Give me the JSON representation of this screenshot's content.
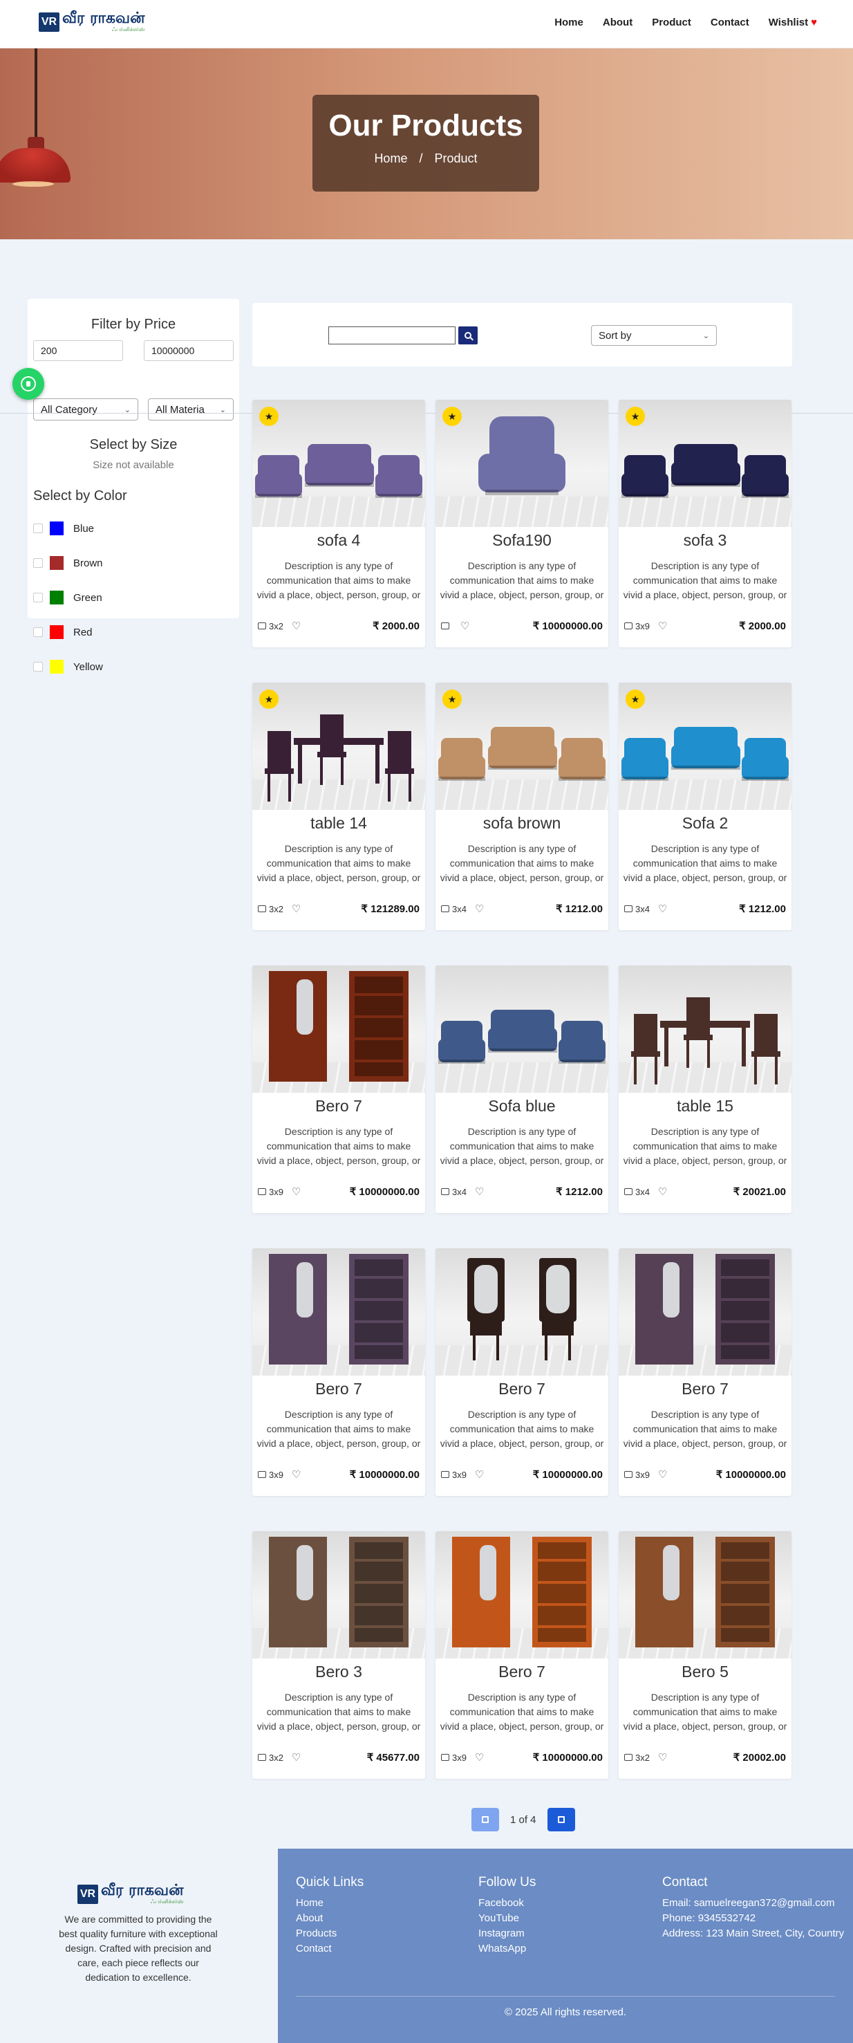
{
  "brand": {
    "logo_text": "வீர ராகவன்",
    "logo_sub": "ஃபர்னிச்சர்ஸ்"
  },
  "nav": {
    "items": [
      "Home",
      "About",
      "Product",
      "Contact",
      "Wishlist"
    ]
  },
  "hero": {
    "title": "Our Products",
    "breadcrumb_home": "Home",
    "breadcrumb_sep": "/",
    "breadcrumb_current": "Product"
  },
  "filters": {
    "price_title": "Filter by Price",
    "price_min": "200",
    "price_max": "10000000",
    "category_selected": "All Category",
    "material_selected": "All Materia",
    "size_title": "Select by Size",
    "size_note": "Size not available",
    "color_title": "Select by Color",
    "colors": [
      {
        "name": "Blue",
        "hex": "#0000ff"
      },
      {
        "name": "Brown",
        "hex": "#a52a2a"
      },
      {
        "name": "Green",
        "hex": "#008000"
      },
      {
        "name": "Red",
        "hex": "#ff0000"
      },
      {
        "name": "Yellow",
        "hex": "#ffff00"
      }
    ]
  },
  "search": {
    "value": "",
    "sort_selected": "Sort by"
  },
  "products": [
    {
      "name": "sofa 4",
      "size": "3x2",
      "price": "₹ 2000.00",
      "featured": true,
      "kind": "sofa-set",
      "color": "#6c5f9a"
    },
    {
      "name": "Sofa190",
      "size": "",
      "price": "₹ 10000000.00",
      "featured": true,
      "kind": "recliner",
      "color": "#6f6fa8"
    },
    {
      "name": "sofa 3",
      "size": "3x9",
      "price": "₹ 2000.00",
      "featured": true,
      "kind": "sofa-set",
      "color": "#22224f"
    },
    {
      "name": "table 14",
      "size": "3x2",
      "price": "₹ 121289.00",
      "featured": true,
      "kind": "dining",
      "color": "#3a2034"
    },
    {
      "name": "sofa brown",
      "size": "3x4",
      "price": "₹ 1212.00",
      "featured": true,
      "kind": "sofa-set",
      "color": "#c09066"
    },
    {
      "name": "Sofa 2",
      "size": "3x4",
      "price": "₹ 1212.00",
      "featured": true,
      "kind": "sofa-set",
      "color": "#1f8fce"
    },
    {
      "name": "Bero 7",
      "size": "3x9",
      "price": "₹ 10000000.00",
      "featured": false,
      "kind": "wardrobe-pair",
      "color": "#7a2a12"
    },
    {
      "name": "Sofa blue",
      "size": "3x4",
      "price": "₹ 1212.00",
      "featured": false,
      "kind": "sofa-set",
      "color": "#3f5a8a"
    },
    {
      "name": "table 15",
      "size": "3x4",
      "price": "₹ 20021.00",
      "featured": false,
      "kind": "dining",
      "color": "#4a2e28"
    },
    {
      "name": "Bero 7",
      "size": "3x9",
      "price": "₹ 10000000.00",
      "featured": false,
      "kind": "wardrobe-pair",
      "color": "#5a4660"
    },
    {
      "name": "Bero 7",
      "size": "3x9",
      "price": "₹ 10000000.00",
      "featured": false,
      "kind": "dresser",
      "color": "#2e1e1a"
    },
    {
      "name": "Bero 7",
      "size": "3x9",
      "price": "₹ 10000000.00",
      "featured": false,
      "kind": "wardrobe-pair",
      "color": "#554055"
    },
    {
      "name": "Bero 3",
      "size": "3x2",
      "price": "₹ 45677.00",
      "featured": false,
      "kind": "wardrobe-pair",
      "color": "#6b5040"
    },
    {
      "name": "Bero 7",
      "size": "3x9",
      "price": "₹ 10000000.00",
      "featured": false,
      "kind": "wardrobe-pair",
      "color": "#c2561a"
    },
    {
      "name": "Bero 5",
      "size": "3x2",
      "price": "₹ 20002.00",
      "featured": false,
      "kind": "wardrobe-pair",
      "color": "#8a4e2a"
    }
  ],
  "product_desc": "Description is any type of communication that aims to make vivid a place, object, person, group, or other physical entity.",
  "pagination": {
    "text": "1 of 4"
  },
  "footer": {
    "desc": "We are committed to providing the best quality furniture with exceptional design. Crafted with precision and care, each piece reflects our dedication to excellence.",
    "quick_links_title": "Quick Links",
    "quick_links": [
      "Home",
      "About",
      "Products",
      "Contact"
    ],
    "follow_title": "Follow Us",
    "follow_links": [
      "Facebook",
      "YouTube",
      "Instagram",
      "WhatsApp"
    ],
    "contact_title": "Contact",
    "email": "Email: samuelreegan372@gmail.com",
    "phone": "Phone: 9345532742",
    "address": "Address: 123 Main Street, City, Country",
    "copyright": "© 2025 All rights reserved."
  }
}
